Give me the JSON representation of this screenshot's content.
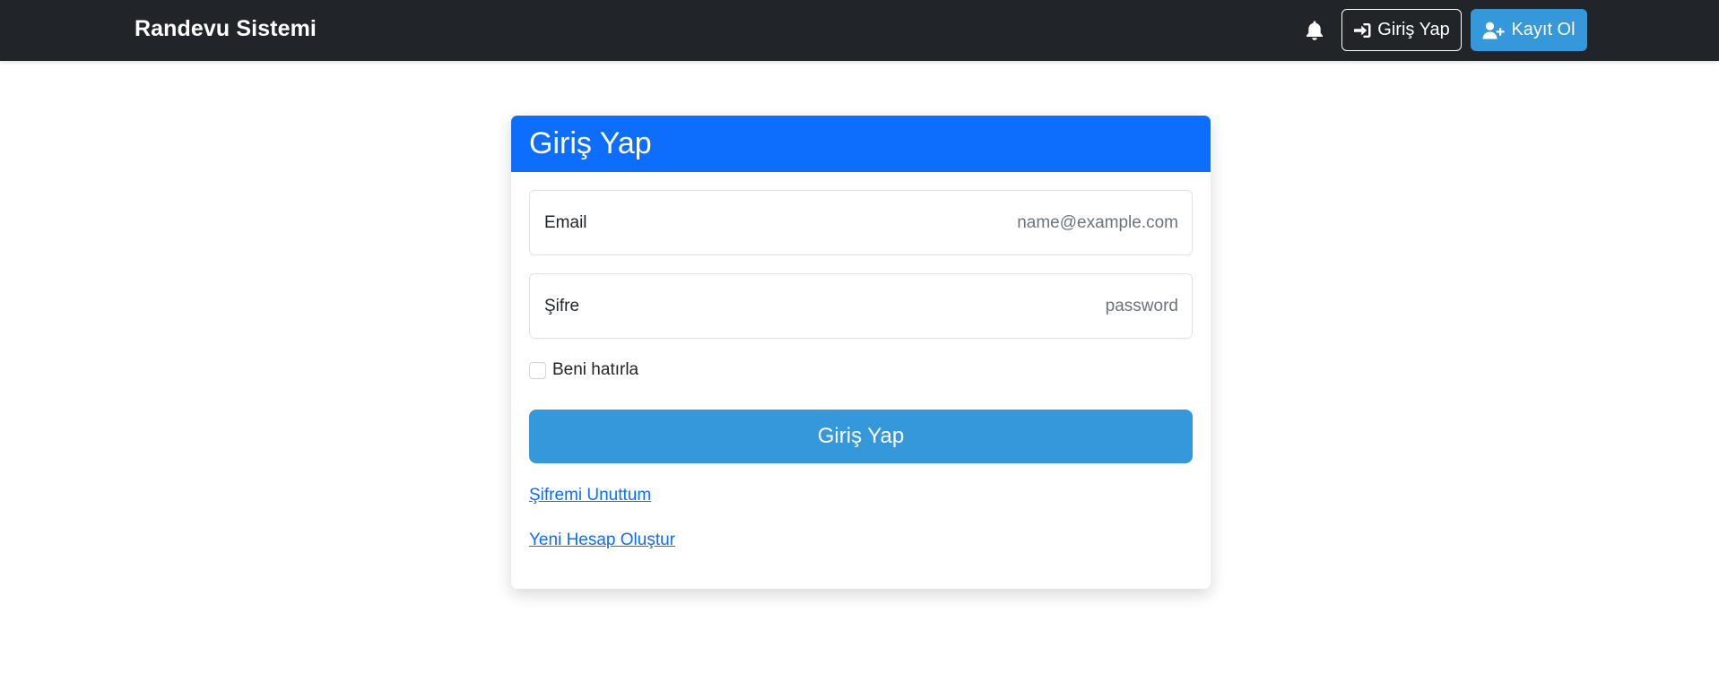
{
  "navbar": {
    "brand": "Randevu Sistemi",
    "notification_icon": "bell-icon",
    "login_label": "Giriş Yap",
    "login_icon": "sign-in-icon",
    "register_label": "Kayıt Ol",
    "register_icon": "user-plus-icon"
  },
  "login_card": {
    "title": "Giriş Yap",
    "email": {
      "label": "Email",
      "value": "",
      "placeholder": "name@example.com"
    },
    "password": {
      "label": "Şifre",
      "value": "",
      "placeholder": "password"
    },
    "remember_label": "Beni hatırla",
    "remember_checked": false,
    "submit_label": "Giriş Yap",
    "forgot_link": "Şifremi Unuttum",
    "new_account_link": "Yeni Hesap Oluştur"
  },
  "colors": {
    "navbar_bg": "#212529",
    "card_header_bg": "#0d6efd",
    "primary_button": "#3498db",
    "link": "#0d6efd"
  }
}
